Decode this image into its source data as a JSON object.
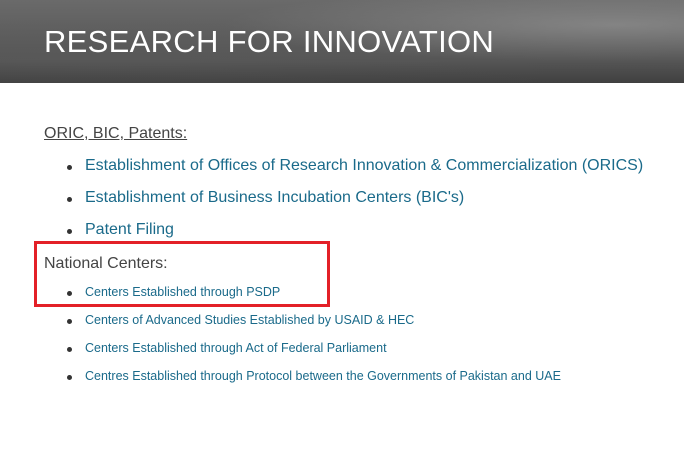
{
  "banner": {
    "title": "RESEARCH FOR INNOVATION"
  },
  "section1": {
    "heading": "ORIC, BIC, Patents:",
    "items": [
      {
        "label": "Establishment of Offices of Research Innovation & Commercialization (ORICS)"
      },
      {
        "label": "Establishment of Business Incubation Centers (BIC's)"
      },
      {
        "label": "Patent Filing"
      }
    ]
  },
  "section2": {
    "heading": "National Centers:",
    "items": [
      {
        "label": "Centers Established through PSDP"
      },
      {
        "label": "Centers of Advanced Studies Established by USAID & HEC"
      },
      {
        "label": "Centers Established through Act of Federal Parliament"
      },
      {
        "label": "Centres Established through Protocol between the Governments of Pakistan and UAE"
      }
    ]
  },
  "colors": {
    "link": "#1a6a8a",
    "heading": "#444444",
    "highlight": "#e32028",
    "banner": "#5a5a5a"
  }
}
